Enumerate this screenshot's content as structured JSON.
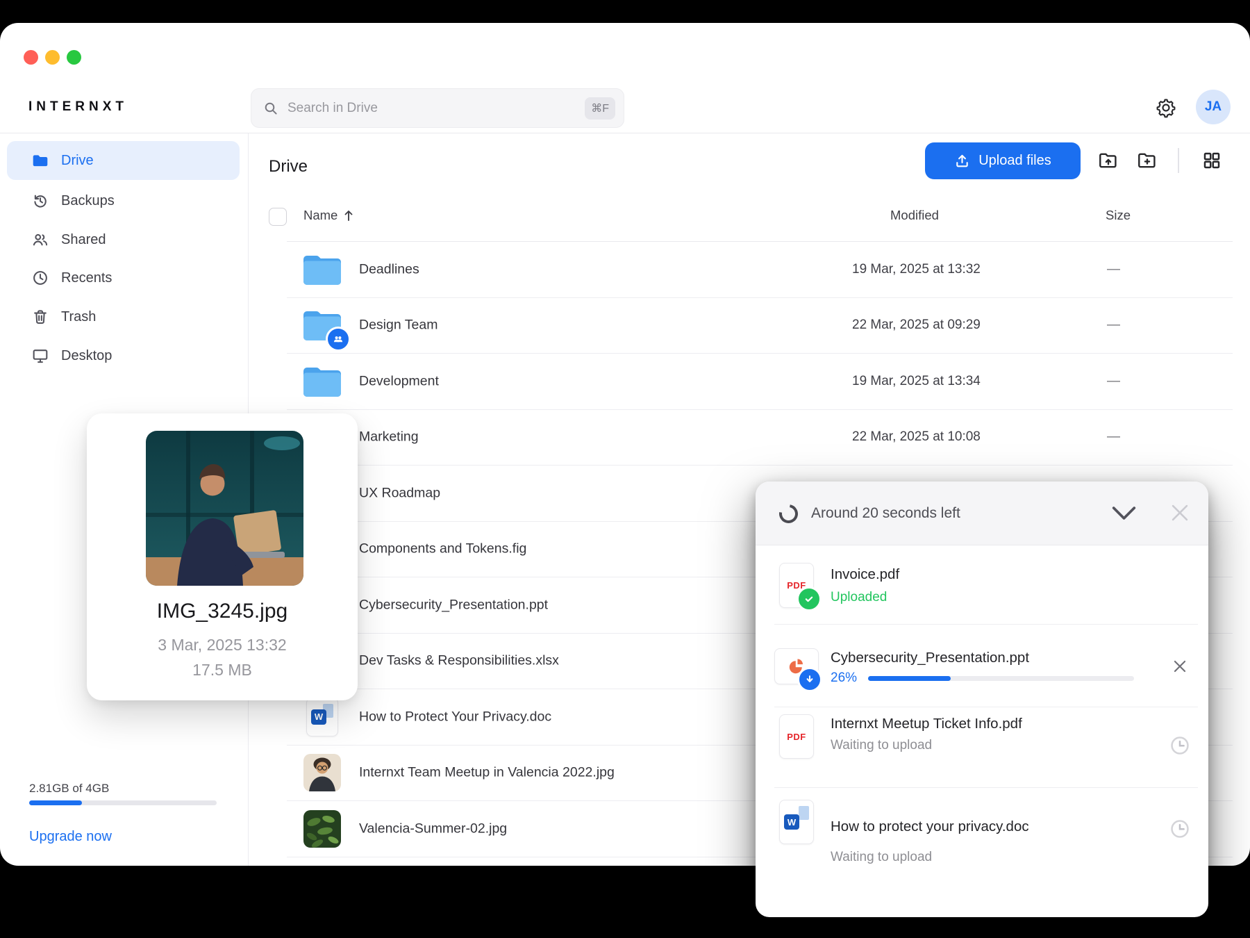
{
  "colors": {
    "accent": "#1B6FF0",
    "green": "#22C55E",
    "pdf_red": "#E5252A",
    "ppt_orange": "#ED6C47",
    "word_blue": "#185ABD",
    "traffic": [
      "#FF5F57",
      "#FEBC2E",
      "#28C840"
    ]
  },
  "header": {
    "logo": "INTERNXT",
    "search": {
      "placeholder": "Search in Drive",
      "shortcut": "⌘F"
    },
    "avatar_initials": "JA"
  },
  "sidebar": {
    "items": [
      {
        "label": "Drive"
      },
      {
        "label": "Backups"
      },
      {
        "label": "Shared"
      },
      {
        "label": "Recents"
      },
      {
        "label": "Trash"
      },
      {
        "label": "Desktop"
      }
    ],
    "storage": {
      "usage": "2.81GB of 4GB",
      "percent_filled": 28,
      "upgrade_label": "Upgrade now"
    }
  },
  "main": {
    "title": "Drive",
    "upload_button_label": "Upload files",
    "table": {
      "columns": {
        "name": "Name",
        "modified": "Modified",
        "size": "Size"
      },
      "rows": [
        {
          "name": "Deadlines",
          "modified": "19 Mar, 2025 at 13:32",
          "size": "—",
          "type": "folder"
        },
        {
          "name": "Design Team",
          "modified": "22 Mar, 2025 at 09:29",
          "size": "—",
          "type": "shared-folder"
        },
        {
          "name": "Development",
          "modified": "19 Mar, 2025 at 13:34",
          "size": "—",
          "type": "folder"
        },
        {
          "name": "Marketing",
          "modified": "22 Mar, 2025 at 10:08",
          "size": "—",
          "type": "folder"
        },
        {
          "name": "UX Roadmap",
          "modified": "",
          "size": "",
          "type": "folder"
        },
        {
          "name": "Components and Tokens.fig",
          "modified": "",
          "size": "",
          "type": "file"
        },
        {
          "name": "Cybersecurity_Presentation.ppt",
          "modified": "",
          "size": "",
          "type": "file"
        },
        {
          "name": "Dev Tasks &amp; Responsibilities.xlsx",
          "modified": "",
          "size": "",
          "type": "file"
        },
        {
          "name": "How to Protect Your Privacy.doc",
          "modified": "",
          "size": "",
          "type": "doc"
        },
        {
          "name": "Internxt Team Meetup in Valencia 2022.jpg",
          "modified": "",
          "size": "",
          "type": "image"
        },
        {
          "name": "Valencia-Summer-02.jpg",
          "modified": "",
          "size": "",
          "type": "image"
        }
      ]
    }
  },
  "preview_card": {
    "filename": "IMG_3245.jpg",
    "date": "3 Mar, 2025 13:32",
    "size": "17.5 MB"
  },
  "upload_panel": {
    "title": "Around 20 seconds left",
    "items": [
      {
        "name": "Invoice.pdf",
        "status": "Uploaded",
        "type": "pdf",
        "state": "done"
      },
      {
        "name": "Cybersecurity_Presentation.ppt",
        "status": "26%",
        "type": "ppt",
        "state": "uploading",
        "progress_visual_percent": 31
      },
      {
        "name": "Internxt Meetup Ticket Info.pdf",
        "status": "Waiting to upload",
        "type": "pdf",
        "state": "waiting"
      },
      {
        "name": "How to protect your privacy.doc",
        "status": "Waiting to upload",
        "type": "doc",
        "state": "waiting"
      }
    ],
    "tile_labels": {
      "pdf": "PDF",
      "word": "W"
    }
  },
  "icons": [
    "magnifier-icon",
    "gear-icon",
    "folder-icon",
    "history-icon",
    "people-icon",
    "clock-icon",
    "trash-icon",
    "monitor-icon",
    "upload-icon",
    "folder-upload-icon",
    "folder-plus-icon",
    "grid-view-icon",
    "sort-up-icon",
    "chevron-down-icon",
    "close-icon",
    "spinner-icon",
    "check-icon",
    "download-arrow-icon",
    "waiting-clock-icon",
    "shared-badge-icon"
  ]
}
